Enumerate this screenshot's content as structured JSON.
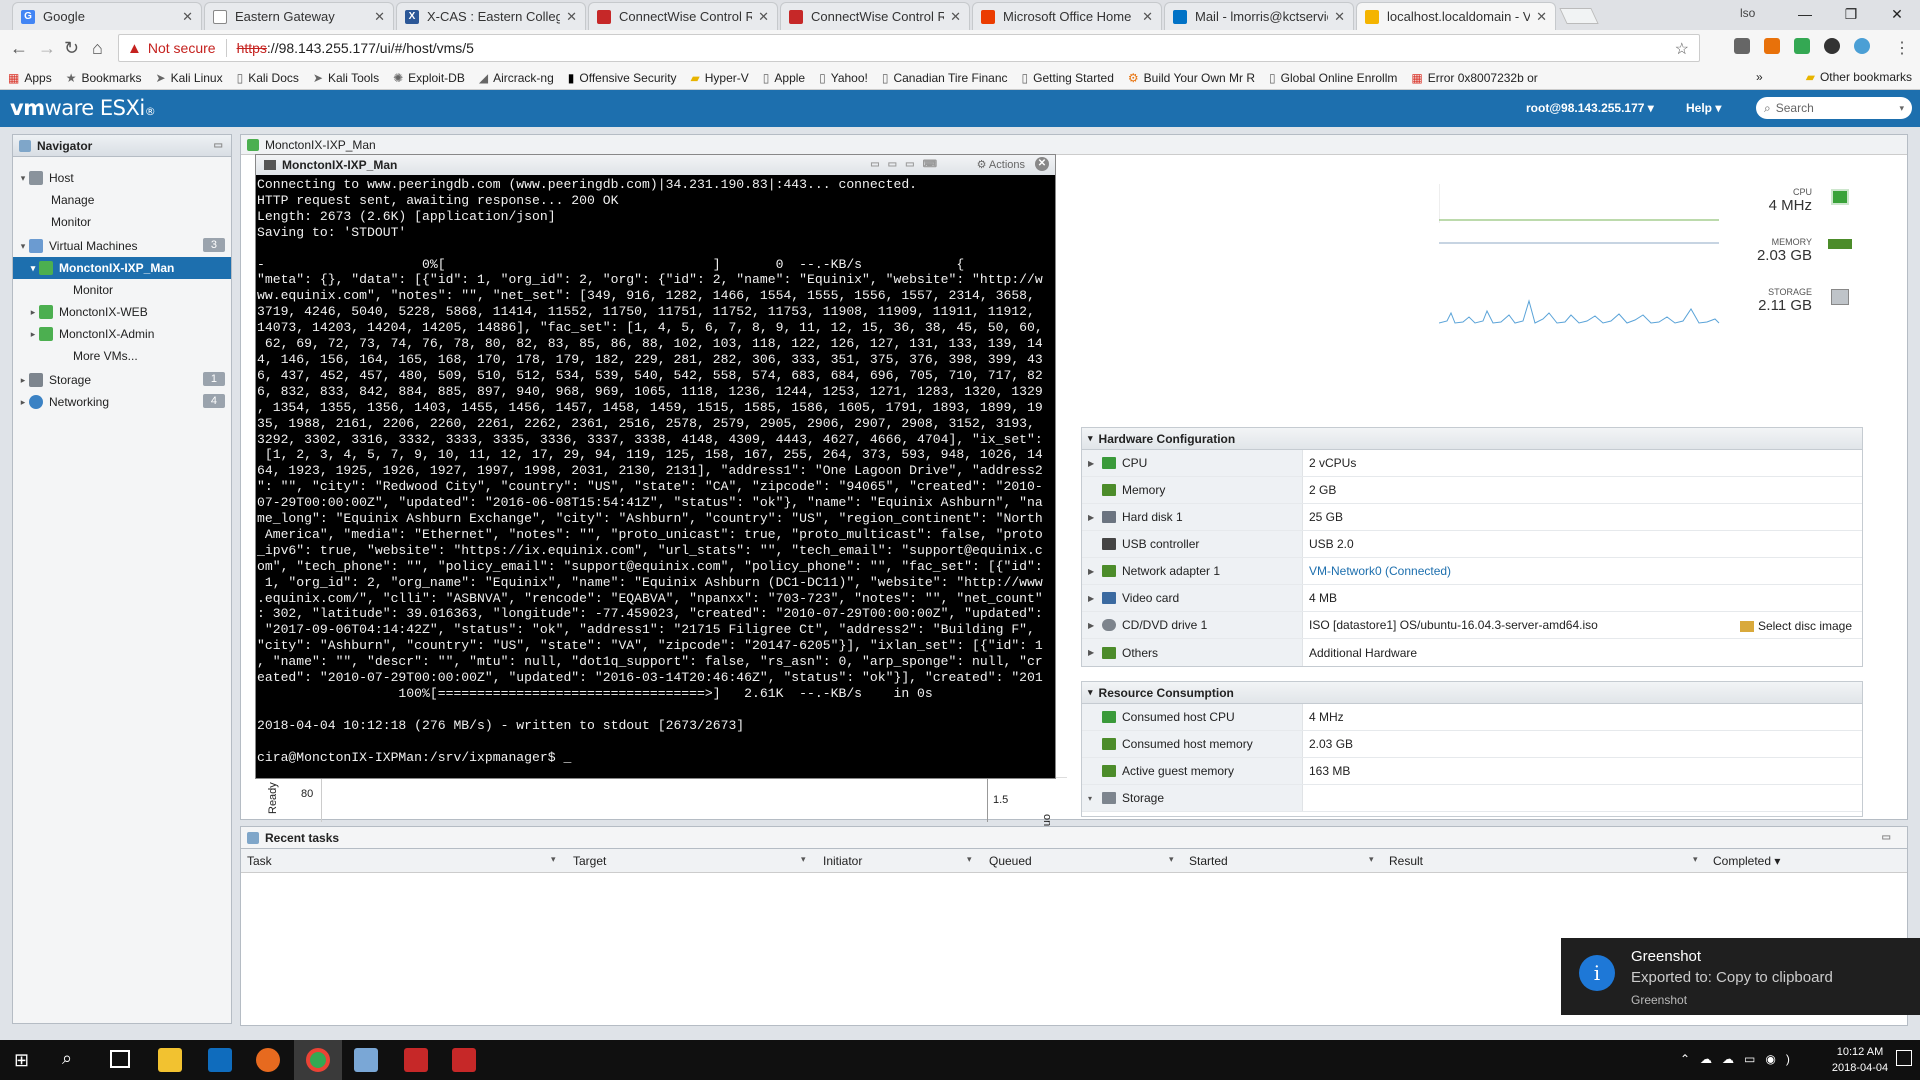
{
  "browser": {
    "tabs": [
      {
        "label": "Google",
        "favicon_color": "#4285f4",
        "favicon": "G"
      },
      {
        "label": "Eastern Gateway",
        "favicon_color": "#777777",
        "favicon": ""
      },
      {
        "label": "X-CAS : Eastern College",
        "favicon_color": "#2b5797",
        "favicon": "X"
      },
      {
        "label": "ConnectWise Control Re",
        "favicon_color": "#c62828",
        "favicon": ""
      },
      {
        "label": "ConnectWise Control Re",
        "favicon_color": "#c62828",
        "favicon": ""
      },
      {
        "label": "Microsoft Office Home",
        "favicon_color": "#eb3c00",
        "favicon": ""
      },
      {
        "label": "Mail - lmorris@kctservic",
        "favicon_color": "#0072c6",
        "favicon": ""
      },
      {
        "label": "localhost.localdomain - V",
        "favicon_color": "#f4b400",
        "favicon": ""
      }
    ],
    "profile": "lso",
    "address": {
      "warning": "Not secure",
      "scheme": "https",
      "rest": "://98.143.255.177/ui/#/host/vms/5"
    },
    "bookmarks": [
      "Apps",
      "Bookmarks",
      "Kali Linux",
      "Kali Docs",
      "Kali Tools",
      "Exploit-DB",
      "Aircrack-ng",
      "Offensive Security",
      "Hyper-V",
      "Apple",
      "Yahoo!",
      "Canadian Tire Financ",
      "Getting Started",
      "Build Your Own Mr R",
      "Global Online Enrollm",
      "Error 0x8007232b or"
    ],
    "other_bookmarks": "Other bookmarks",
    "more": "»"
  },
  "esxi": {
    "logo_vm": "vm",
    "logo_rest": "ware ESXi",
    "user": "root@98.143.255.177",
    "help": "Help",
    "search_placeholder": "Search"
  },
  "navigator": {
    "title": "Navigator",
    "items": [
      {
        "label": "Host",
        "level": 0
      },
      {
        "label": "Manage",
        "level": 1
      },
      {
        "label": "Monitor",
        "level": 1
      },
      {
        "label": "Virtual Machines",
        "level": 0,
        "badge": "3"
      },
      {
        "label": "MonctonIX-IXP_Man",
        "level": 1
      },
      {
        "label": "Monitor",
        "level": 2
      },
      {
        "label": "MonctonIX-WEB",
        "level": 1
      },
      {
        "label": "MonctonIX-Admin",
        "level": 1
      },
      {
        "label": "More VMs...",
        "level": 1
      },
      {
        "label": "Storage",
        "level": 0,
        "badge": "1"
      },
      {
        "label": "Networking",
        "level": 0,
        "badge": "4"
      }
    ]
  },
  "vm": {
    "title": "MonctonIX-IXP_Man",
    "stats": {
      "cpu_label": "CPU",
      "cpu_value": "4 MHz",
      "memory_label": "MEMORY",
      "memory_value": "2.03 GB",
      "storage_label": "STORAGE",
      "storage_value": "2.11 GB"
    },
    "hardware": {
      "title": "Hardware Configuration",
      "rows": [
        {
          "key": "CPU",
          "value": "2 vCPUs",
          "icon_color": "#3a9a3a"
        },
        {
          "key": "Memory",
          "value": "2 GB",
          "icon_color": "#4c8c2a"
        },
        {
          "key": "Hard disk 1",
          "value": "25 GB",
          "icon_color": "#6b7480"
        },
        {
          "key": "USB controller",
          "value": "USB 2.0",
          "icon_color": "#444444"
        },
        {
          "key": "Network adapter 1",
          "value": "VM-Network0 (Connected)",
          "icon_color": "#4c8c2a"
        },
        {
          "key": "Video card",
          "value": "4 MB",
          "icon_color": "#3b6aa0"
        },
        {
          "key": "CD/DVD drive 1",
          "value": "ISO [datastore1] OS/ubuntu-16.04.3-server-amd64.iso",
          "icon_color": "#7d848c"
        },
        {
          "key": "Others",
          "value": "Additional Hardware",
          "icon_color": "#4c8c2a"
        }
      ],
      "select_disc": "Select disc image"
    },
    "resources": {
      "title": "Resource Consumption",
      "rows": [
        {
          "key": "Consumed host CPU",
          "value": "4 MHz"
        },
        {
          "key": "Consumed host memory",
          "value": "2.03 GB"
        },
        {
          "key": "Active guest memory",
          "value": "163 MB"
        },
        {
          "key": "Storage",
          "value": ""
        }
      ]
    },
    "behind_chart": {
      "y_tick": "80",
      "y_label": "Ready",
      "right_tick": "1.5",
      "right_label": "onsu"
    }
  },
  "console": {
    "title": "MonctonIX-IXP_Man",
    "actions": "Actions",
    "lines": [
      "Connecting to www.peeringdb.com (www.peeringdb.com)|34.231.190.83|:443... connected.",
      "HTTP request sent, awaiting response... 200 OK",
      "Length: 2673 (2.6K) [application/json]",
      "Saving to: 'STDOUT'",
      "",
      "-                    0%[                                  ]       0  --.-KB/s            {",
      "\"meta\": {}, \"data\": [{\"id\": 1, \"org_id\": 2, \"org\": {\"id\": 2, \"name\": \"Equinix\", \"website\": \"http://w",
      "ww.equinix.com\", \"notes\": \"\", \"net_set\": [349, 916, 1282, 1466, 1554, 1555, 1556, 1557, 2314, 3658,",
      "3719, 4246, 5040, 5228, 5868, 11414, 11552, 11750, 11751, 11752, 11753, 11908, 11909, 11911, 11912,",
      "14073, 14203, 14204, 14205, 14886], \"fac_set\": [1, 4, 5, 6, 7, 8, 9, 11, 12, 15, 36, 38, 45, 50, 60,",
      " 62, 69, 72, 73, 74, 76, 78, 80, 82, 83, 85, 86, 88, 102, 103, 118, 122, 126, 127, 131, 133, 139, 14",
      "4, 146, 156, 164, 165, 168, 170, 178, 179, 182, 229, 281, 282, 306, 333, 351, 375, 376, 398, 399, 43",
      "6, 437, 452, 457, 480, 509, 510, 512, 534, 539, 540, 542, 558, 574, 683, 684, 696, 705, 710, 717, 82",
      "6, 832, 833, 842, 884, 885, 897, 940, 968, 969, 1065, 1118, 1236, 1244, 1253, 1271, 1283, 1320, 1329",
      ", 1354, 1355, 1356, 1403, 1455, 1456, 1457, 1458, 1459, 1515, 1585, 1586, 1605, 1791, 1893, 1899, 19",
      "35, 1988, 2161, 2206, 2260, 2261, 2262, 2361, 2516, 2578, 2579, 2905, 2906, 2907, 2908, 3152, 3193,",
      "3292, 3302, 3316, 3332, 3333, 3335, 3336, 3337, 3338, 4148, 4309, 4443, 4627, 4666, 4704], \"ix_set\":",
      " [1, 2, 3, 4, 5, 7, 9, 10, 11, 12, 17, 29, 94, 119, 125, 158, 167, 255, 264, 373, 593, 948, 1026, 14",
      "64, 1923, 1925, 1926, 1927, 1997, 1998, 2031, 2130, 2131], \"address1\": \"One Lagoon Drive\", \"address2",
      "\": \"\", \"city\": \"Redwood City\", \"country\": \"US\", \"state\": \"CA\", \"zipcode\": \"94065\", \"created\": \"2010-",
      "07-29T00:00:00Z\", \"updated\": \"2016-06-08T15:54:41Z\", \"status\": \"ok\"}, \"name\": \"Equinix Ashburn\", \"na",
      "me_long\": \"Equinix Ashburn Exchange\", \"city\": \"Ashburn\", \"country\": \"US\", \"region_continent\": \"North",
      " America\", \"media\": \"Ethernet\", \"notes\": \"\", \"proto_unicast\": true, \"proto_multicast\": false, \"proto",
      "_ipv6\": true, \"website\": \"https://ix.equinix.com\", \"url_stats\": \"\", \"tech_email\": \"support@equinix.c",
      "om\", \"tech_phone\": \"\", \"policy_email\": \"support@equinix.com\", \"policy_phone\": \"\", \"fac_set\": [{\"id\":",
      " 1, \"org_id\": 2, \"org_name\": \"Equinix\", \"name\": \"Equinix Ashburn (DC1-DC11)\", \"website\": \"http://www",
      ".equinix.com/\", \"clli\": \"ASBNVA\", \"rencode\": \"EQABVA\", \"npanxx\": \"703-723\", \"notes\": \"\", \"net_count\"",
      ": 302, \"latitude\": 39.016363, \"longitude\": -77.459023, \"created\": \"2010-07-29T00:00:00Z\", \"updated\":",
      " \"2017-09-06T04:14:42Z\", \"status\": \"ok\", \"address1\": \"21715 Filigree Ct\", \"address2\": \"Building F\",",
      "\"city\": \"Ashburn\", \"country\": \"US\", \"state\": \"VA\", \"zipcode\": \"20147-6205\"}], \"ixlan_set\": [{\"id\": 1",
      ", \"name\": \"\", \"descr\": \"\", \"mtu\": null, \"dot1q_support\": false, \"rs_asn\": 0, \"arp_sponge\": null, \"cr",
      "eated\": \"2010-07-29T00:00:00Z\", \"updated\": \"2016-03-14T20:46:46Z\", \"status\": \"ok\"}], \"created\": \"201",
      "                  100%[==================================>]   2.61K  --.-KB/s    in 0s",
      "",
      "2018-04-04 10:12:18 (276 MB/s) - written to stdout [2673/2673]",
      "",
      "cira@MonctonIX-IXPMan:/srv/ixpmanager$ _"
    ]
  },
  "tasks": {
    "title": "Recent tasks",
    "columns": [
      "Task",
      "Target",
      "Initiator",
      "Queued",
      "Started",
      "Result",
      "Completed ▾"
    ]
  },
  "toast": {
    "title": "Greenshot",
    "message": "Exported to: Copy to clipboard",
    "source": "Greenshot"
  },
  "taskbar": {
    "time": "10:12 AM",
    "date": "2018-04-04"
  }
}
